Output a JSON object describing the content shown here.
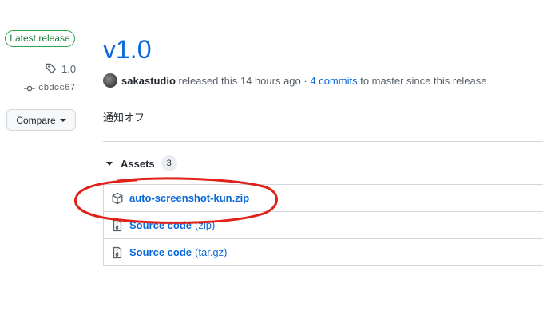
{
  "sidebar": {
    "badge": "Latest release",
    "tag": "1.0",
    "commit": "cbdcc67",
    "compare_label": "Compare"
  },
  "release": {
    "title": "v1.0",
    "author": "sakastudio",
    "released_text": "released this 14 hours ago",
    "separator": "·",
    "commits_link": "4 commits",
    "since_text": "to master since this release",
    "body": "通知オフ"
  },
  "assets": {
    "heading": "Assets",
    "count": "3",
    "items": [
      {
        "name": "auto-screenshot-kun.zip",
        "ext": "",
        "icon": "package-icon"
      },
      {
        "name": "Source code",
        "ext": "(zip)",
        "icon": "file-zip-icon"
      },
      {
        "name": "Source code",
        "ext": "(tar.gz)",
        "icon": "file-zip-icon"
      }
    ]
  },
  "colors": {
    "link": "#0969da",
    "badge_green": "#1a7f37",
    "annotation_red": "#e0211a"
  }
}
